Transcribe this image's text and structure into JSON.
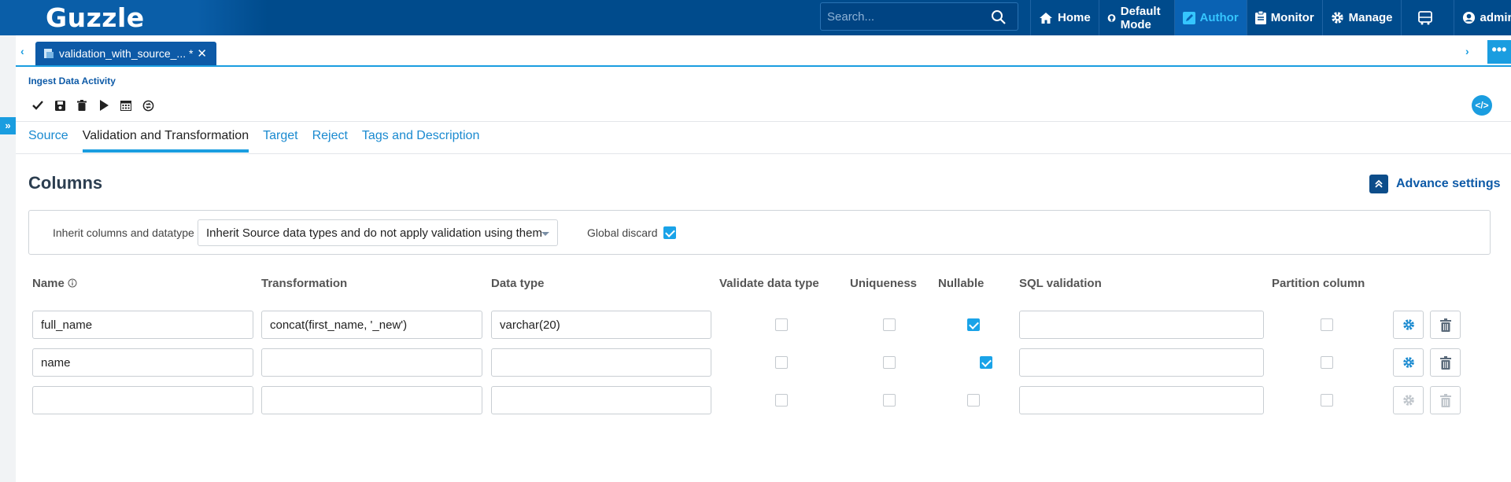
{
  "app": {
    "logo_text": "Guzzle",
    "search_placeholder": "Search...",
    "nav": [
      {
        "label": "Home",
        "icon": "home-icon"
      },
      {
        "label": "Default Mode",
        "icon": "github-icon"
      },
      {
        "label": "Author",
        "icon": "pencil-square-icon",
        "active": true
      },
      {
        "label": "Monitor",
        "icon": "clipboard-icon"
      },
      {
        "label": "Manage",
        "icon": "gear-icon"
      },
      {
        "label": "",
        "icon": "bus-icon"
      },
      {
        "label": "admin",
        "icon": "user-circle-icon"
      }
    ]
  },
  "tabs": {
    "open_doc": "validation_with_source_... *",
    "close_glyph": "✕",
    "more_glyph": "•••"
  },
  "activity": {
    "title": "Ingest Data Activity",
    "toolbar": [
      "check-icon",
      "save-icon",
      "trash-icon",
      "play-icon",
      "calendar-icon",
      "sync-icon"
    ],
    "code_label": "</>"
  },
  "subtabs": [
    "Source",
    "Validation and Transformation",
    "Target",
    "Reject",
    "Tags and Description"
  ],
  "active_subtab": "Validation and Transformation",
  "columns": {
    "title": "Columns",
    "advance_settings": "Advance settings",
    "inherit_label": "Inherit columns and datatype",
    "inherit_value": "Inherit Source data types and do not apply validation using them",
    "global_discard_label": "Global discard",
    "global_discard": true,
    "headers": [
      "Name",
      "Transformation",
      "Data type",
      "Validate data type",
      "Uniqueness",
      "Nullable",
      "SQL validation",
      "Partition column"
    ],
    "rows": [
      {
        "name": "full_name",
        "transformation": "concat(first_name, '_new')",
        "data_type": "varchar(20)",
        "validate": false,
        "unique": false,
        "nullable": true,
        "sql": "",
        "partition": false,
        "enabled": true
      },
      {
        "name": "name",
        "transformation": "",
        "data_type": "",
        "validate": false,
        "unique": false,
        "nullable": true,
        "sql": "",
        "partition": false,
        "enabled": true
      },
      {
        "name": "",
        "transformation": "",
        "data_type": "",
        "validate": false,
        "unique": false,
        "nullable": false,
        "sql": "",
        "partition": false,
        "enabled": false
      }
    ]
  },
  "colors": {
    "accent": "#1a9de0",
    "brand": "#004b8c"
  }
}
